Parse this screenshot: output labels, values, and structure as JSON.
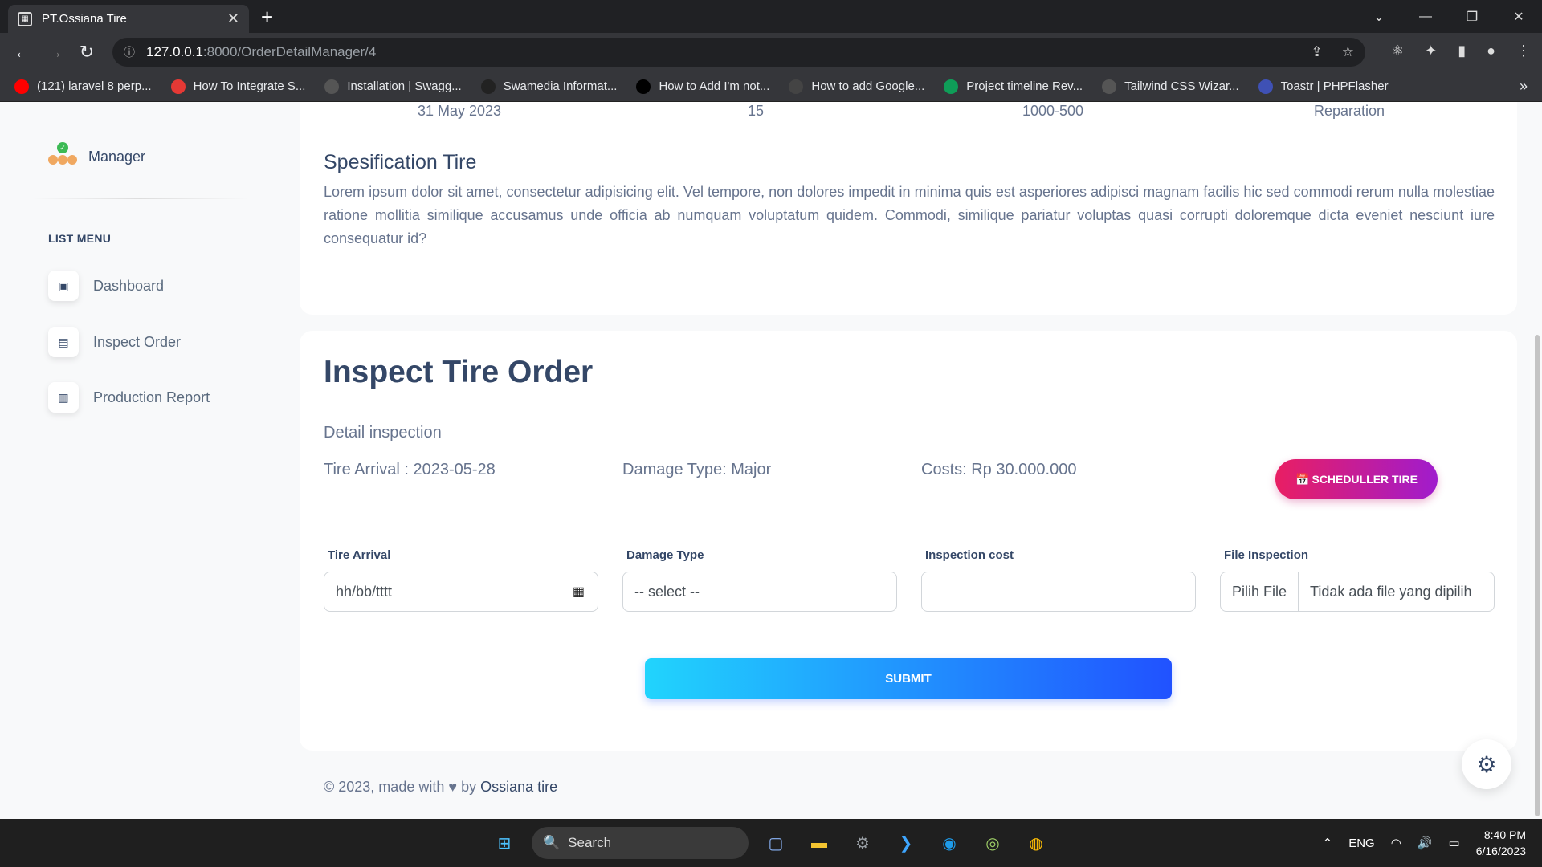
{
  "browser": {
    "tab_title": "PT.Ossiana Tire",
    "url_host": "127.0.0.1",
    "url_path": ":8000/OrderDetailManager/4",
    "bookmarks": [
      {
        "label": "(121) laravel 8 perp...",
        "color": "#ff0000"
      },
      {
        "label": "How To Integrate S...",
        "color": "#e53935"
      },
      {
        "label": "Installation | Swagg...",
        "color": "#555555"
      },
      {
        "label": "Swamedia Informat...",
        "color": "#222222"
      },
      {
        "label": "How to Add I'm not...",
        "color": "#000000"
      },
      {
        "label": "How to add Google...",
        "color": "#444444"
      },
      {
        "label": "Project timeline Rev...",
        "color": "#0f9d58"
      },
      {
        "label": "Tailwind CSS Wizar...",
        "color": "#555555"
      },
      {
        "label": "Toastr | PHPFlasher",
        "color": "#3f51b5"
      }
    ]
  },
  "sidebar": {
    "brand": "Manager",
    "menu_heading": "LIST MENU",
    "items": [
      {
        "label": "Dashboard",
        "icon": "store-icon"
      },
      {
        "label": "Inspect Order",
        "icon": "basket-icon"
      },
      {
        "label": "Production Report",
        "icon": "document-icon"
      }
    ]
  },
  "order_row": {
    "date": "31 May 2023",
    "qty": "15",
    "size": "1000-500",
    "service": "Reparation"
  },
  "spec": {
    "title": "Spesification Tire",
    "text": "Lorem ipsum dolor sit amet, consectetur adipisicing elit. Vel tempore, non dolores impedit in minima quis est asperiores adipisci magnam facilis hic sed commodi rerum nulla molestiae ratione mollitia similique accusamus unde officia ab numquam voluptatum quidem. Commodi, similique pariatur voluptas quasi corrupti doloremque dicta eveniet nesciunt iure consequatur id?"
  },
  "inspect": {
    "title": "Inspect Tire Order",
    "subtitle": "Detail inspection",
    "tire_arrival": "Tire Arrival : 2023-05-28",
    "damage_type": "Damage Type: Major",
    "costs": "Costs: Rp 30.000.000",
    "schedule_button": "SCHEDULLER TIRE",
    "form": {
      "arrival_label": "Tire Arrival",
      "arrival_value": "hh/bb/tttt",
      "damage_label": "Damage Type",
      "damage_value": "-- select --",
      "cost_label": "Inspection cost",
      "cost_value": "",
      "file_label": "File Inspection",
      "file_button": "Pilih File",
      "file_status": "Tidak ada file yang dipilih"
    },
    "submit": "SUBMIT"
  },
  "footer": {
    "prefix": "© 2023, made with",
    "by": "by",
    "brand": "Ossiana tire"
  },
  "taskbar": {
    "search": "Search",
    "lang": "ENG",
    "time": "8:40 PM",
    "date": "6/16/2023"
  },
  "colors": {
    "accent_pink": "#e91e63",
    "accent_blue": "#2152ff",
    "text_dark": "#344767"
  }
}
